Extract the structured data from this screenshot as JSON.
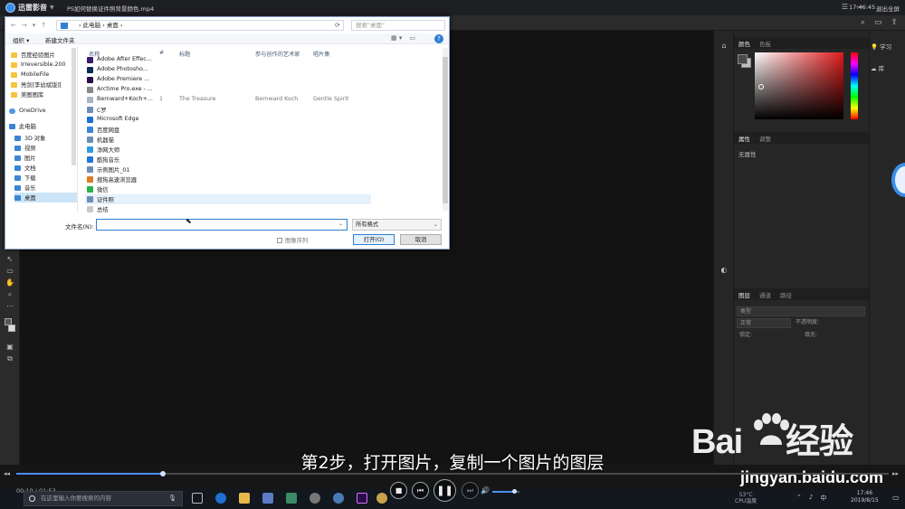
{
  "player": {
    "app_name": "迅雷影音",
    "video_title": "PS如何替换证件照背景颜色.mp4",
    "clock": "17:46:45",
    "exit_fullscreen": "退出全屏",
    "progress_fraction": 0.168,
    "time": "00:19 / 01:53",
    "subtitle": "第2步，打开图片，复制一个图片的图层",
    "volume_fraction": 0.8
  },
  "photoshop": {
    "color_tabs": [
      "颜色",
      "色板"
    ],
    "props_tabs": [
      "属性",
      "调整"
    ],
    "no_properties": "无属性",
    "layers_tabs": [
      "图层",
      "通道",
      "路径"
    ],
    "layer_kind": "类型",
    "blend_mode": "正常",
    "opacity_label": "不透明度:",
    "lock_label": "锁定:",
    "fill_label": "填充:",
    "learn": "学习",
    "library": "库",
    "fg_color": "#4a4a4a",
    "bg_color": "#bdbdbd"
  },
  "dialog": {
    "path": [
      "此电脑",
      "桌面"
    ],
    "search_placeholder": "搜索\"桌面\"",
    "organize": "组织 ▾",
    "new_folder": "新建文件夹",
    "nav_items": [
      {
        "label": "百度经验图片",
        "type": "folder"
      },
      {
        "label": "Irreversible.200",
        "type": "folder"
      },
      {
        "label": "MobileFile",
        "type": "folder"
      },
      {
        "label": "亮剑[李幼斌版][",
        "type": "folder"
      },
      {
        "label": "美图图库",
        "type": "folder"
      },
      {
        "label": "OneDrive",
        "type": "cloud"
      },
      {
        "label": "此电脑",
        "type": "pc"
      },
      {
        "label": "3D 对象",
        "type": "blue"
      },
      {
        "label": "视频",
        "type": "blue"
      },
      {
        "label": "图片",
        "type": "blue"
      },
      {
        "label": "文档",
        "type": "blue"
      },
      {
        "label": "下载",
        "type": "blue"
      },
      {
        "label": "音乐",
        "type": "blue"
      },
      {
        "label": "桌面",
        "type": "blue"
      }
    ],
    "columns": [
      "名称",
      "#",
      "标题",
      "参与创作的艺术家",
      "唱片集"
    ],
    "files": [
      {
        "name": "Adobe After Effec...",
        "color": "#3a1d6e",
        "num": "",
        "title": "",
        "artist": "",
        "album": ""
      },
      {
        "name": "Adobe Photosho...",
        "color": "#0c2a54",
        "num": "",
        "title": "",
        "artist": "",
        "album": ""
      },
      {
        "name": "Adobe Premiere ...",
        "color": "#2b0b4a",
        "num": "",
        "title": "",
        "artist": "",
        "album": ""
      },
      {
        "name": "Arctime Pro.exe - ...",
        "color": "#888888",
        "num": "",
        "title": "",
        "artist": "",
        "album": ""
      },
      {
        "name": "Bernward+Koch+...",
        "color": "#aab4c4",
        "num": "1",
        "title": "The Treasure",
        "artist": "Bernward Koch",
        "album": "Gentle Spirit"
      },
      {
        "name": "C罗",
        "color": "#6d8db8",
        "num": "",
        "title": "",
        "artist": "",
        "album": ""
      },
      {
        "name": "Microsoft Edge",
        "color": "#1e6fd0",
        "num": "",
        "title": "",
        "artist": "",
        "album": ""
      },
      {
        "name": "百度网盘",
        "color": "#3b86d4",
        "num": "",
        "title": "",
        "artist": "",
        "album": ""
      },
      {
        "name": "机器猫",
        "color": "#6d8db8",
        "num": "",
        "title": "",
        "artist": "",
        "album": ""
      },
      {
        "name": "净网大师",
        "color": "#2f9be0",
        "num": "",
        "title": "",
        "artist": "",
        "album": ""
      },
      {
        "name": "酷狗音乐",
        "color": "#1f78d6",
        "num": "",
        "title": "",
        "artist": "",
        "album": ""
      },
      {
        "name": "示例图片_01",
        "color": "#6d8db8",
        "num": "",
        "title": "",
        "artist": "",
        "album": ""
      },
      {
        "name": "搜狗高速浏览器",
        "color": "#e07b22",
        "num": "",
        "title": "",
        "artist": "",
        "album": ""
      },
      {
        "name": "微信",
        "color": "#2bb24c",
        "num": "",
        "title": "",
        "artist": "",
        "album": ""
      },
      {
        "name": "证件照",
        "color": "#6d8db8",
        "num": "",
        "title": "",
        "artist": "",
        "album": ""
      },
      {
        "name": "总结",
        "color": "#c9c9c9",
        "num": "",
        "title": "",
        "artist": "",
        "album": ""
      }
    ],
    "highlighted_index": 14,
    "filename_label": "文件名(N):",
    "filename_value": "",
    "filetype": "所有格式",
    "image_sequence": "图像序列",
    "open_button": "打开(O)",
    "cancel_button": "取消"
  },
  "watermark": {
    "logo": "Bai",
    "logo2": "经验",
    "url": "jingyan.baidu.com"
  },
  "taskbar": {
    "search_placeholder": "在这里输入你要搜索的内容",
    "cpu_temp": "53°C",
    "cpu_label": "CPU温度",
    "ime": "中",
    "time": "17:46",
    "date": "2019/8/15"
  }
}
